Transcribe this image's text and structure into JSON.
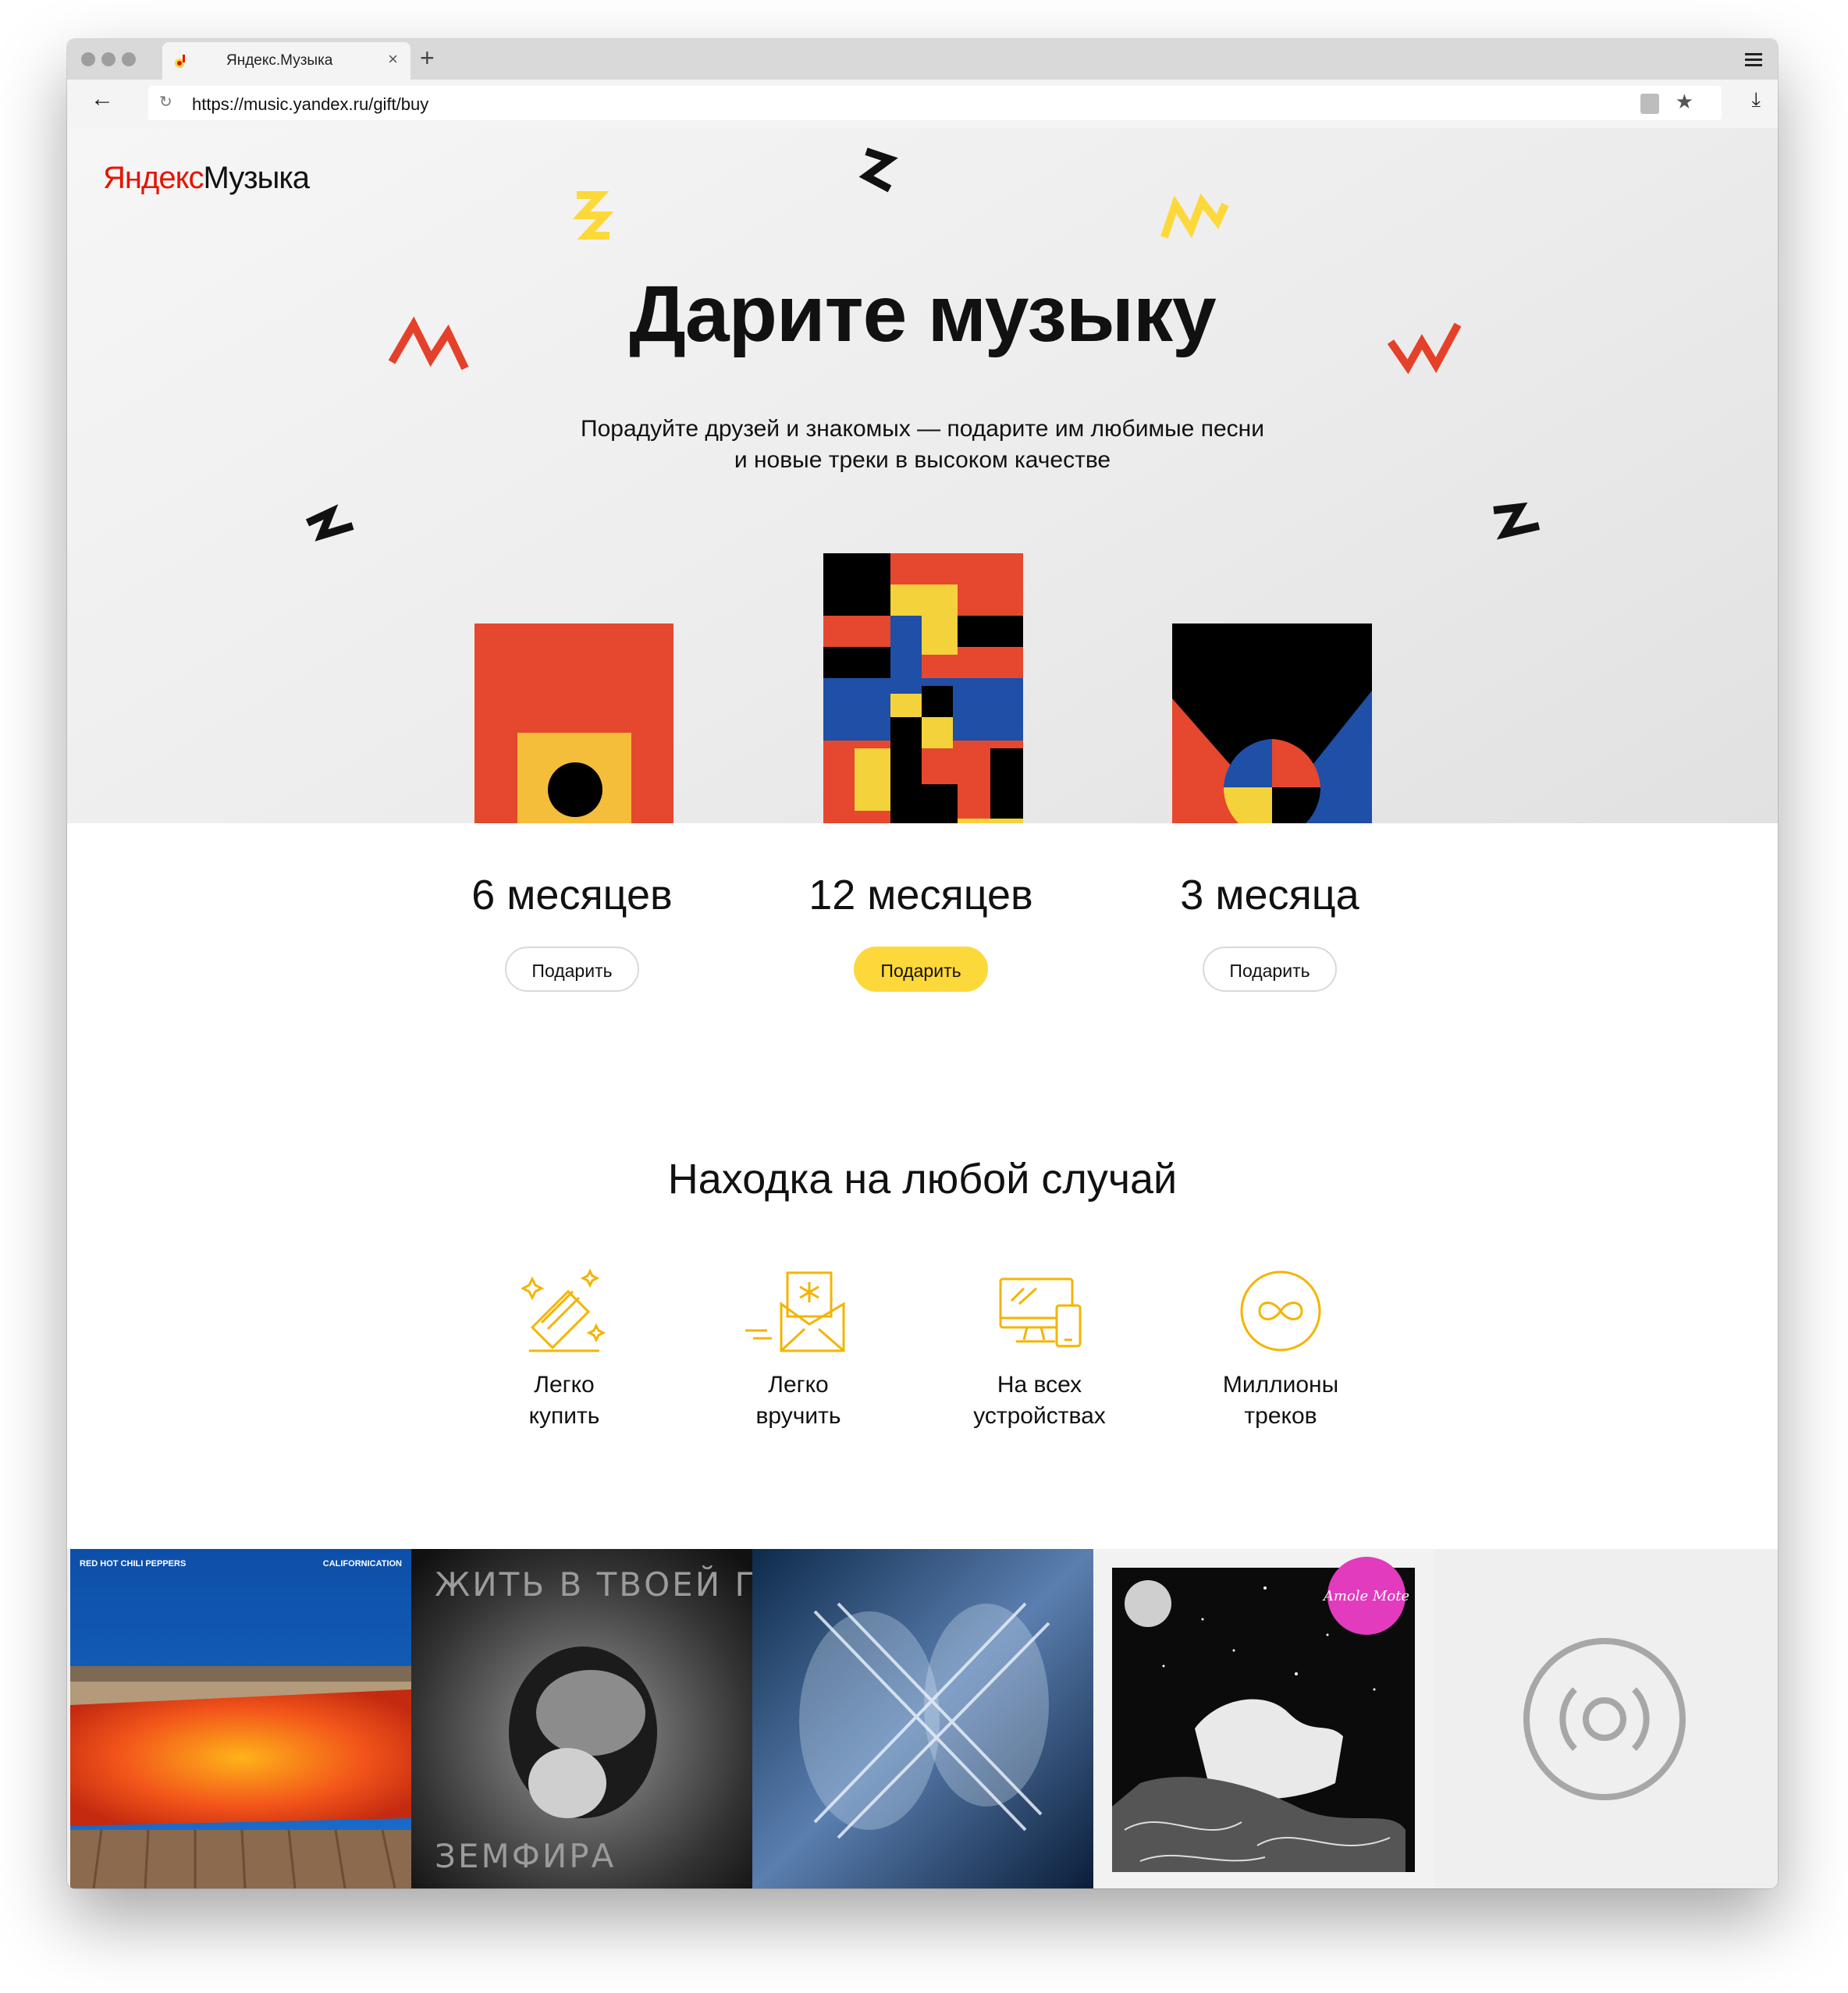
{
  "browser": {
    "tab_title": "Яндекс.Музыка",
    "url": "https://music.yandex.ru/gift/buy",
    "icons": [
      "back-arrow-icon",
      "reload-icon",
      "lock-icon",
      "star-icon",
      "download-icon",
      "menu-icon",
      "close-icon",
      "new-tab-icon"
    ]
  },
  "logo": {
    "brand": "Яндекс",
    "product": "Музыка"
  },
  "hero": {
    "title": "Дарите музыку",
    "subtitle_line1": "Порадуйте друзей и знакомых — подарите им любимые песни",
    "subtitle_line2": "и новые треки в высоком качестве"
  },
  "plans": [
    {
      "title": "6 месяцев",
      "button": "Подарить"
    },
    {
      "title": "12 месяцев",
      "button": "Подарить"
    },
    {
      "title": "3 месяца",
      "button": "Подарить"
    }
  ],
  "features_title": "Находка на любой случай",
  "features": [
    {
      "line1": "Легко",
      "line2": "купить",
      "icon": "gift-card-icon"
    },
    {
      "line1": "Легко",
      "line2": "вручить",
      "icon": "envelope-icon"
    },
    {
      "line1": "На всех",
      "line2": "устройствах",
      "icon": "devices-icon"
    },
    {
      "line1": "Миллионы",
      "line2": "треков",
      "icon": "infinity-icon"
    }
  ],
  "albums": {
    "album1_band": "RED HOT CHILI PEPPERS",
    "album1_title": "CALIFORNICATION",
    "album2_title": "ЖИТЬ В ТВОЕЙ ГОЛОВЕ",
    "album2_band": "ЗЕМФИРА",
    "album4_badge": "Amole Mote"
  },
  "colors": {
    "accent_yellow": "#fdd83a",
    "brand_red": "#e61400",
    "cover_red": "#e5482e",
    "cover_blue": "#1f4fa6"
  }
}
